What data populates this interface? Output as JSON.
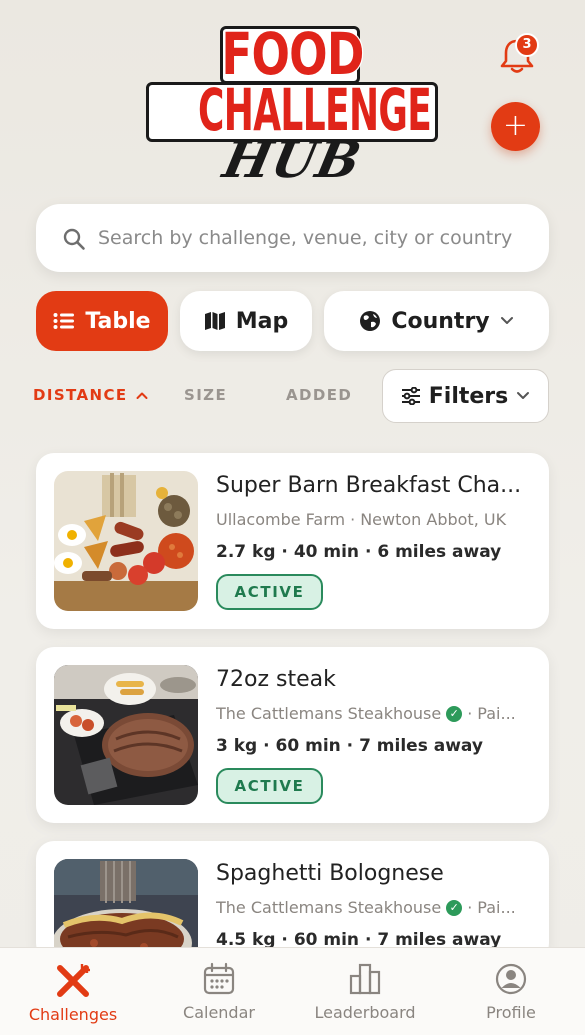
{
  "app": {
    "logo_line1": "FOOD",
    "logo_line2": "CHALLENGE",
    "logo_line3": "HUB",
    "notification_count": "3",
    "add_label": "+"
  },
  "search": {
    "placeholder": "Search by challenge, venue, city or country"
  },
  "view_toggle": {
    "table_label": "Table",
    "map_label": "Map",
    "country_label": "Country",
    "active": "Table"
  },
  "sort": {
    "distance_label": "DISTANCE",
    "size_label": "SIZE",
    "added_label": "ADDED",
    "active": "DISTANCE",
    "direction": "ascending",
    "filters_label": "Filters"
  },
  "challenges": [
    {
      "title": "Super Barn Breakfast Cha...",
      "venue": "Ullacombe Farm",
      "location": "Newton Abbot, UK",
      "verified": false,
      "weight": "2.7 kg",
      "time": "40 min",
      "distance": "6 miles away",
      "status": "ACTIVE",
      "image": "breakfast-platter"
    },
    {
      "title": "72oz steak",
      "venue": "The Cattlemans Steakhouse",
      "location": "Pai...",
      "verified": true,
      "weight": "3 kg",
      "time": "60 min",
      "distance": "7 miles away",
      "status": "ACTIVE",
      "image": "steak-platter"
    },
    {
      "title": "Spaghetti Bolognese",
      "venue": "The Cattlemans Steakhouse",
      "location": "Pai...",
      "verified": true,
      "weight": "4.5 kg",
      "time": "60 min",
      "distance": "7 miles away",
      "status": "",
      "image": "spaghetti-bolognese"
    }
  ],
  "nav": {
    "items": [
      {
        "label": "Challenges",
        "icon": "fork-knife-icon",
        "active": true
      },
      {
        "label": "Calendar",
        "icon": "calendar-icon",
        "active": false
      },
      {
        "label": "Leaderboard",
        "icon": "leaderboard-icon",
        "active": false
      },
      {
        "label": "Profile",
        "icon": "profile-icon",
        "active": false
      }
    ]
  },
  "colors": {
    "accent": "#e23b14",
    "background": "#ebe8e1",
    "badge_bg": "#d8f1e4",
    "badge_border": "#2a8a5c",
    "verified": "#2d9a5a"
  }
}
